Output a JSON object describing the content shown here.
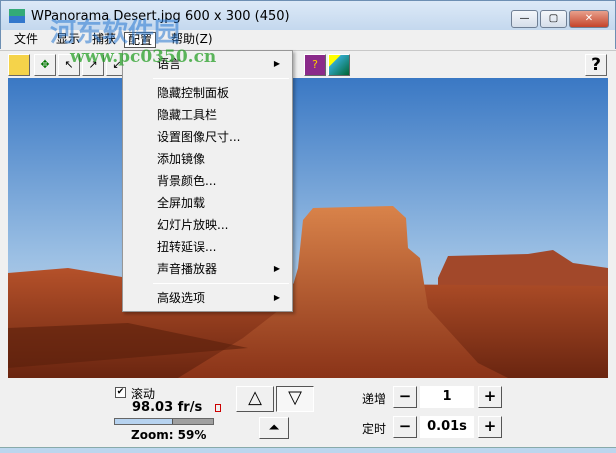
{
  "window": {
    "title": "WPanorama  Desert.jpg   600 x 300 (450)",
    "minimize": "—",
    "maximize": "▢",
    "close": "✕"
  },
  "menubar": [
    "文件",
    "显示",
    "捕获",
    "配置",
    "帮助(Z)"
  ],
  "toolbar": {
    "help_label": "?"
  },
  "dropdown": {
    "items": [
      {
        "label": "语言",
        "submenu": true
      },
      {
        "label": "隐藏控制面板"
      },
      {
        "label": "隐藏工具栏"
      },
      {
        "label": "设置图像尺寸..."
      },
      {
        "label": "添加镜像"
      },
      {
        "label": "背景颜色..."
      },
      {
        "label": "全屏加载"
      },
      {
        "label": "幻灯片放映..."
      },
      {
        "label": "扭转延误..."
      },
      {
        "label": "声音播放器",
        "submenu": true
      },
      {
        "label": "高级选项",
        "submenu": true
      }
    ],
    "arrow": "▶"
  },
  "panel": {
    "scroll_label": "滚动",
    "scroll_checked": true,
    "fps": "98.03 fr/s",
    "zoom_label": "Zoom: 59%",
    "zoom_fraction": 0.59,
    "up": "△",
    "down": "▽",
    "top": "⏶",
    "increment_label": "递增",
    "increment_value": "1",
    "timer_label": "定时",
    "timer_value": "0.01s",
    "minus": "−",
    "plus": "+"
  },
  "watermark": {
    "text": "河东软件园",
    "url": "www.pc0350.cn"
  }
}
